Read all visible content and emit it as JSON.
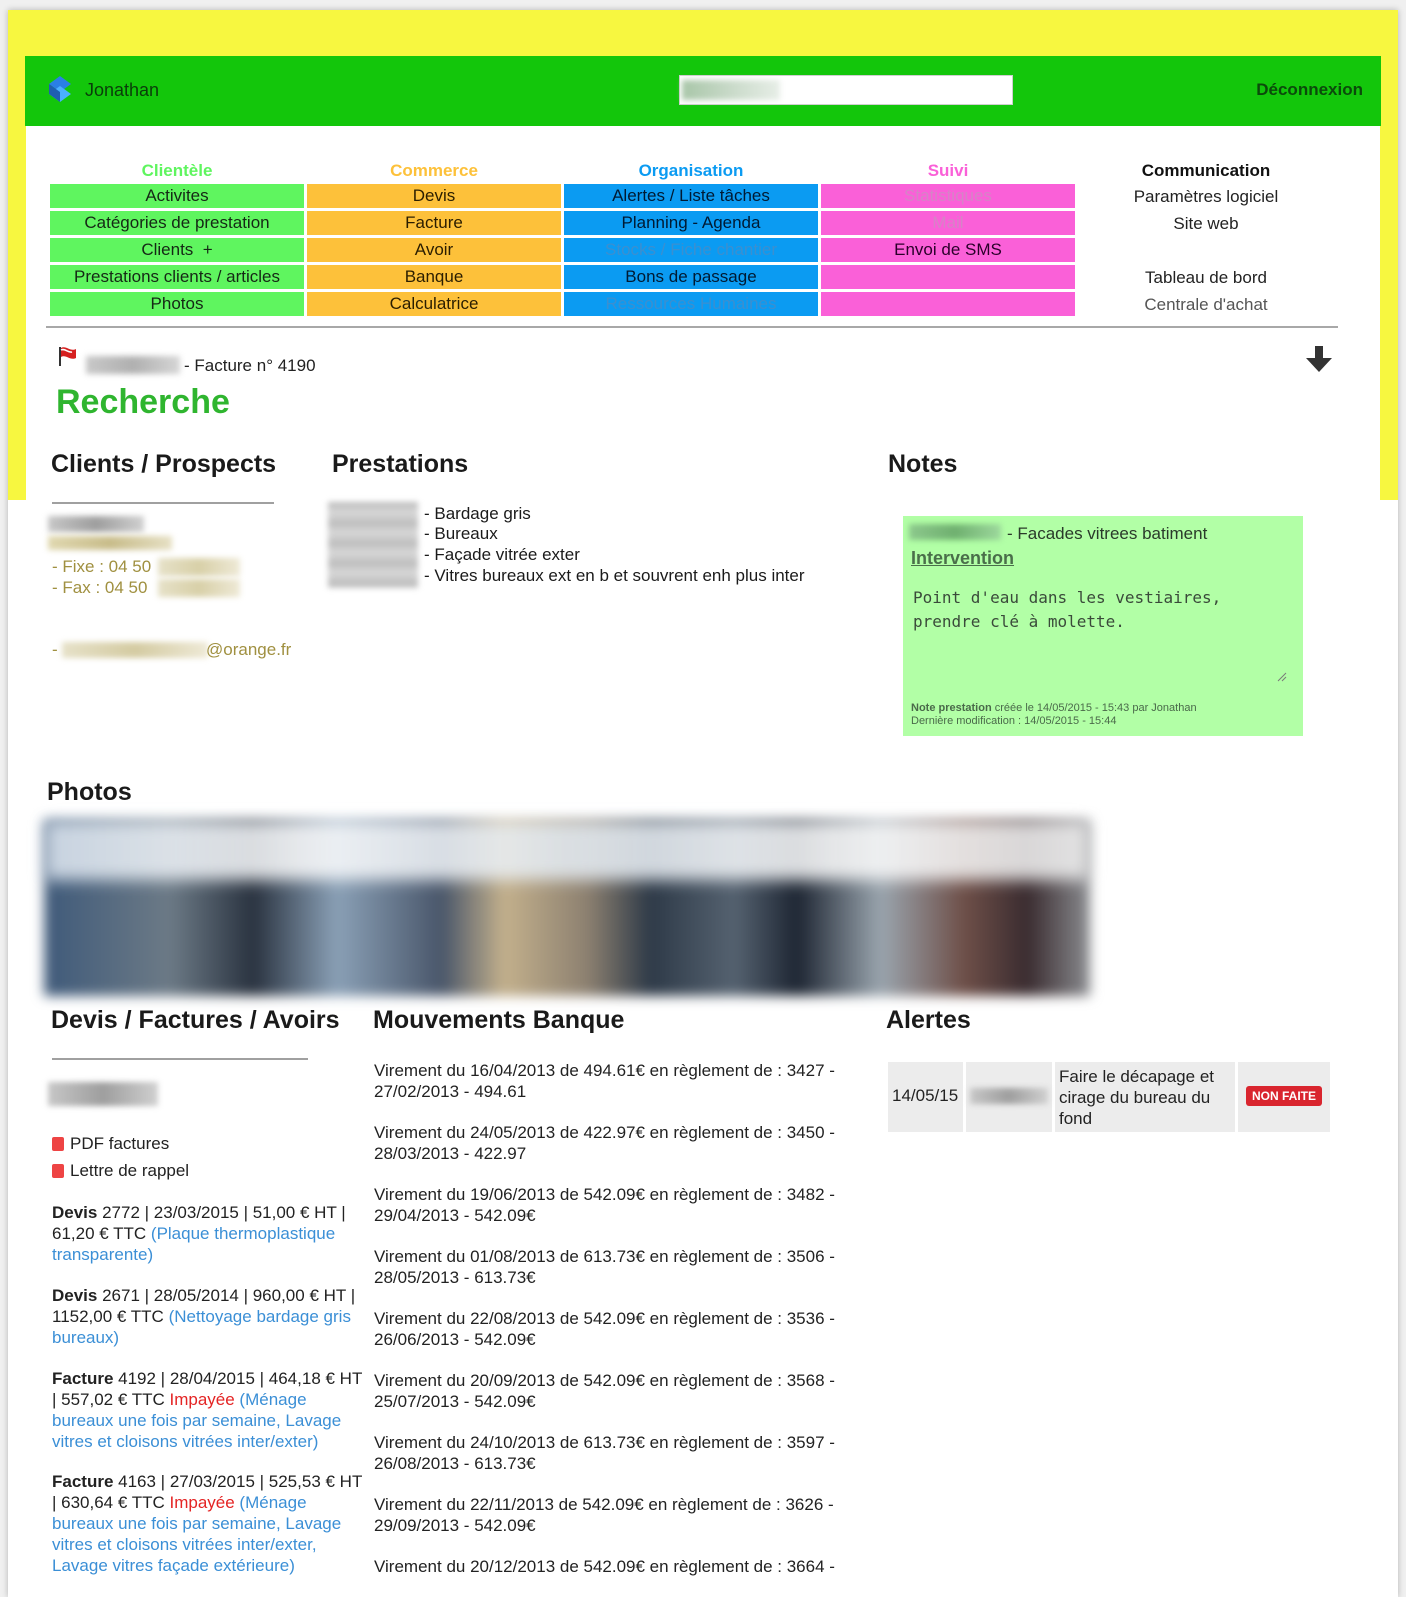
{
  "header": {
    "username": "Jonathan",
    "logout_label": "Déconnexion"
  },
  "menu": {
    "clientele": {
      "title": "Clientèle",
      "items": [
        "Activites",
        "Catégories de prestation",
        "Clients  +",
        "Prestations clients / articles",
        "Photos"
      ]
    },
    "commerce": {
      "title": "Commerce",
      "items": [
        "Devis",
        "Facture",
        "Avoir",
        "Banque",
        "Calculatrice"
      ]
    },
    "organisation": {
      "title": "Organisation",
      "items": [
        "Alertes / Liste tâches",
        "Planning - Agenda",
        "Stocks / Fiche chantier",
        "Bons de passage",
        "Ressources Humaines"
      ]
    },
    "suivi": {
      "title": "Suivi",
      "items": [
        "Statistiques",
        "Mail",
        "Envoi de SMS",
        ""
      ]
    },
    "communication": {
      "title": "Communication",
      "items": [
        "Paramètres logiciel",
        "Site web",
        "",
        "Tableau de bord",
        "Centrale d'achat"
      ]
    },
    "colors": {
      "clientele": "#5ff55f",
      "commerce": "#fdc13a",
      "organisation": "#0b9bf2",
      "suivi": "#fa60d8"
    }
  },
  "breadcrumb": {
    "text": "- Facture n° 4190"
  },
  "page_title": "Recherche",
  "clients": {
    "heading": "Clients / Prospects",
    "fixe": "- Fixe : 04 50",
    "fax": "- Fax : 04 50",
    "email_prefix": "-",
    "email_suffix": "@orange.fr"
  },
  "prestations": {
    "heading": "Prestations",
    "items": [
      "- Bardage gris",
      "- Bureaux",
      "- Façade vitrée exter",
      "- Vitres bureaux ext en b et souvrent enh plus inter"
    ]
  },
  "notes": {
    "heading": "Notes",
    "label": "- Facades vitrees batiment",
    "link": "Intervention",
    "content": "Point d'eau dans les vestiaires,\nprendre clé à molette.",
    "meta_created_prefix": "Note prestation",
    "meta_created": " créée le 14/05/2015 - 15:43 par Jonathan",
    "meta_modified": "Dernière modification : 14/05/2015 - 15:44"
  },
  "photos": {
    "heading": "Photos"
  },
  "documents": {
    "heading": "Devis / Factures / Avoirs",
    "links": [
      "PDF factures",
      "Lettre de rappel"
    ],
    "entries": [
      {
        "type": "Devis",
        "detail": " 2772 | 23/03/2015 | 51,00 € HT | 61,20 € TTC ",
        "status": "",
        "desc": "(Plaque thermoplastique transparente)"
      },
      {
        "type": "Devis",
        "detail": " 2671 | 28/05/2014 | 960,00 € HT | 1152,00 € TTC ",
        "status": "",
        "desc": "(Nettoyage bardage gris bureaux)"
      },
      {
        "type": "Facture",
        "detail": " 4192 | 28/04/2015 | 464,18 € HT | 557,02 € TTC ",
        "status": "Impayée",
        "desc": " (Ménage bureaux une fois par semaine, Lavage vitres et cloisons vitrées inter/exter)"
      },
      {
        "type": "Facture",
        "detail": " 4163 | 27/03/2015 | 525,53 € HT | 630,64 € TTC ",
        "status": "Impayée",
        "desc": " (Ménage bureaux une fois par semaine, Lavage vitres et cloisons vitrées inter/exter, Lavage vitres façade extérieure)"
      }
    ]
  },
  "bank": {
    "heading": "Mouvements Banque",
    "entries": [
      "Virement du 16/04/2013 de 494.61€ en règlement de : 3427 - 27/02/2013 - 494.61",
      "Virement du 24/05/2013 de 422.97€ en règlement de : 3450 - 28/03/2013 - 422.97",
      "Virement du 19/06/2013 de 542.09€ en règlement de : 3482 - 29/04/2013 - 542.09€",
      "Virement du 01/08/2013 de 613.73€ en règlement de : 3506 - 28/05/2013 - 613.73€",
      "Virement du 22/08/2013 de 542.09€ en règlement de : 3536 - 26/06/2013 - 542.09€",
      "Virement du 20/09/2013 de 542.09€ en règlement de : 3568 - 25/07/2013 - 542.09€",
      "Virement du 24/10/2013 de 613.73€ en règlement de : 3597 - 26/08/2013 - 613.73€",
      "Virement du 22/11/2013 de 542.09€ en règlement de : 3626 - 29/09/2013 - 542.09€",
      "Virement du 20/12/2013 de 542.09€ en règlement de : 3664 -"
    ]
  },
  "alerts": {
    "heading": "Alertes",
    "items": [
      {
        "date": "14/05/15",
        "text": "Faire le décapage et cirage du bureau du fond",
        "status": "NON FAITE"
      }
    ]
  }
}
